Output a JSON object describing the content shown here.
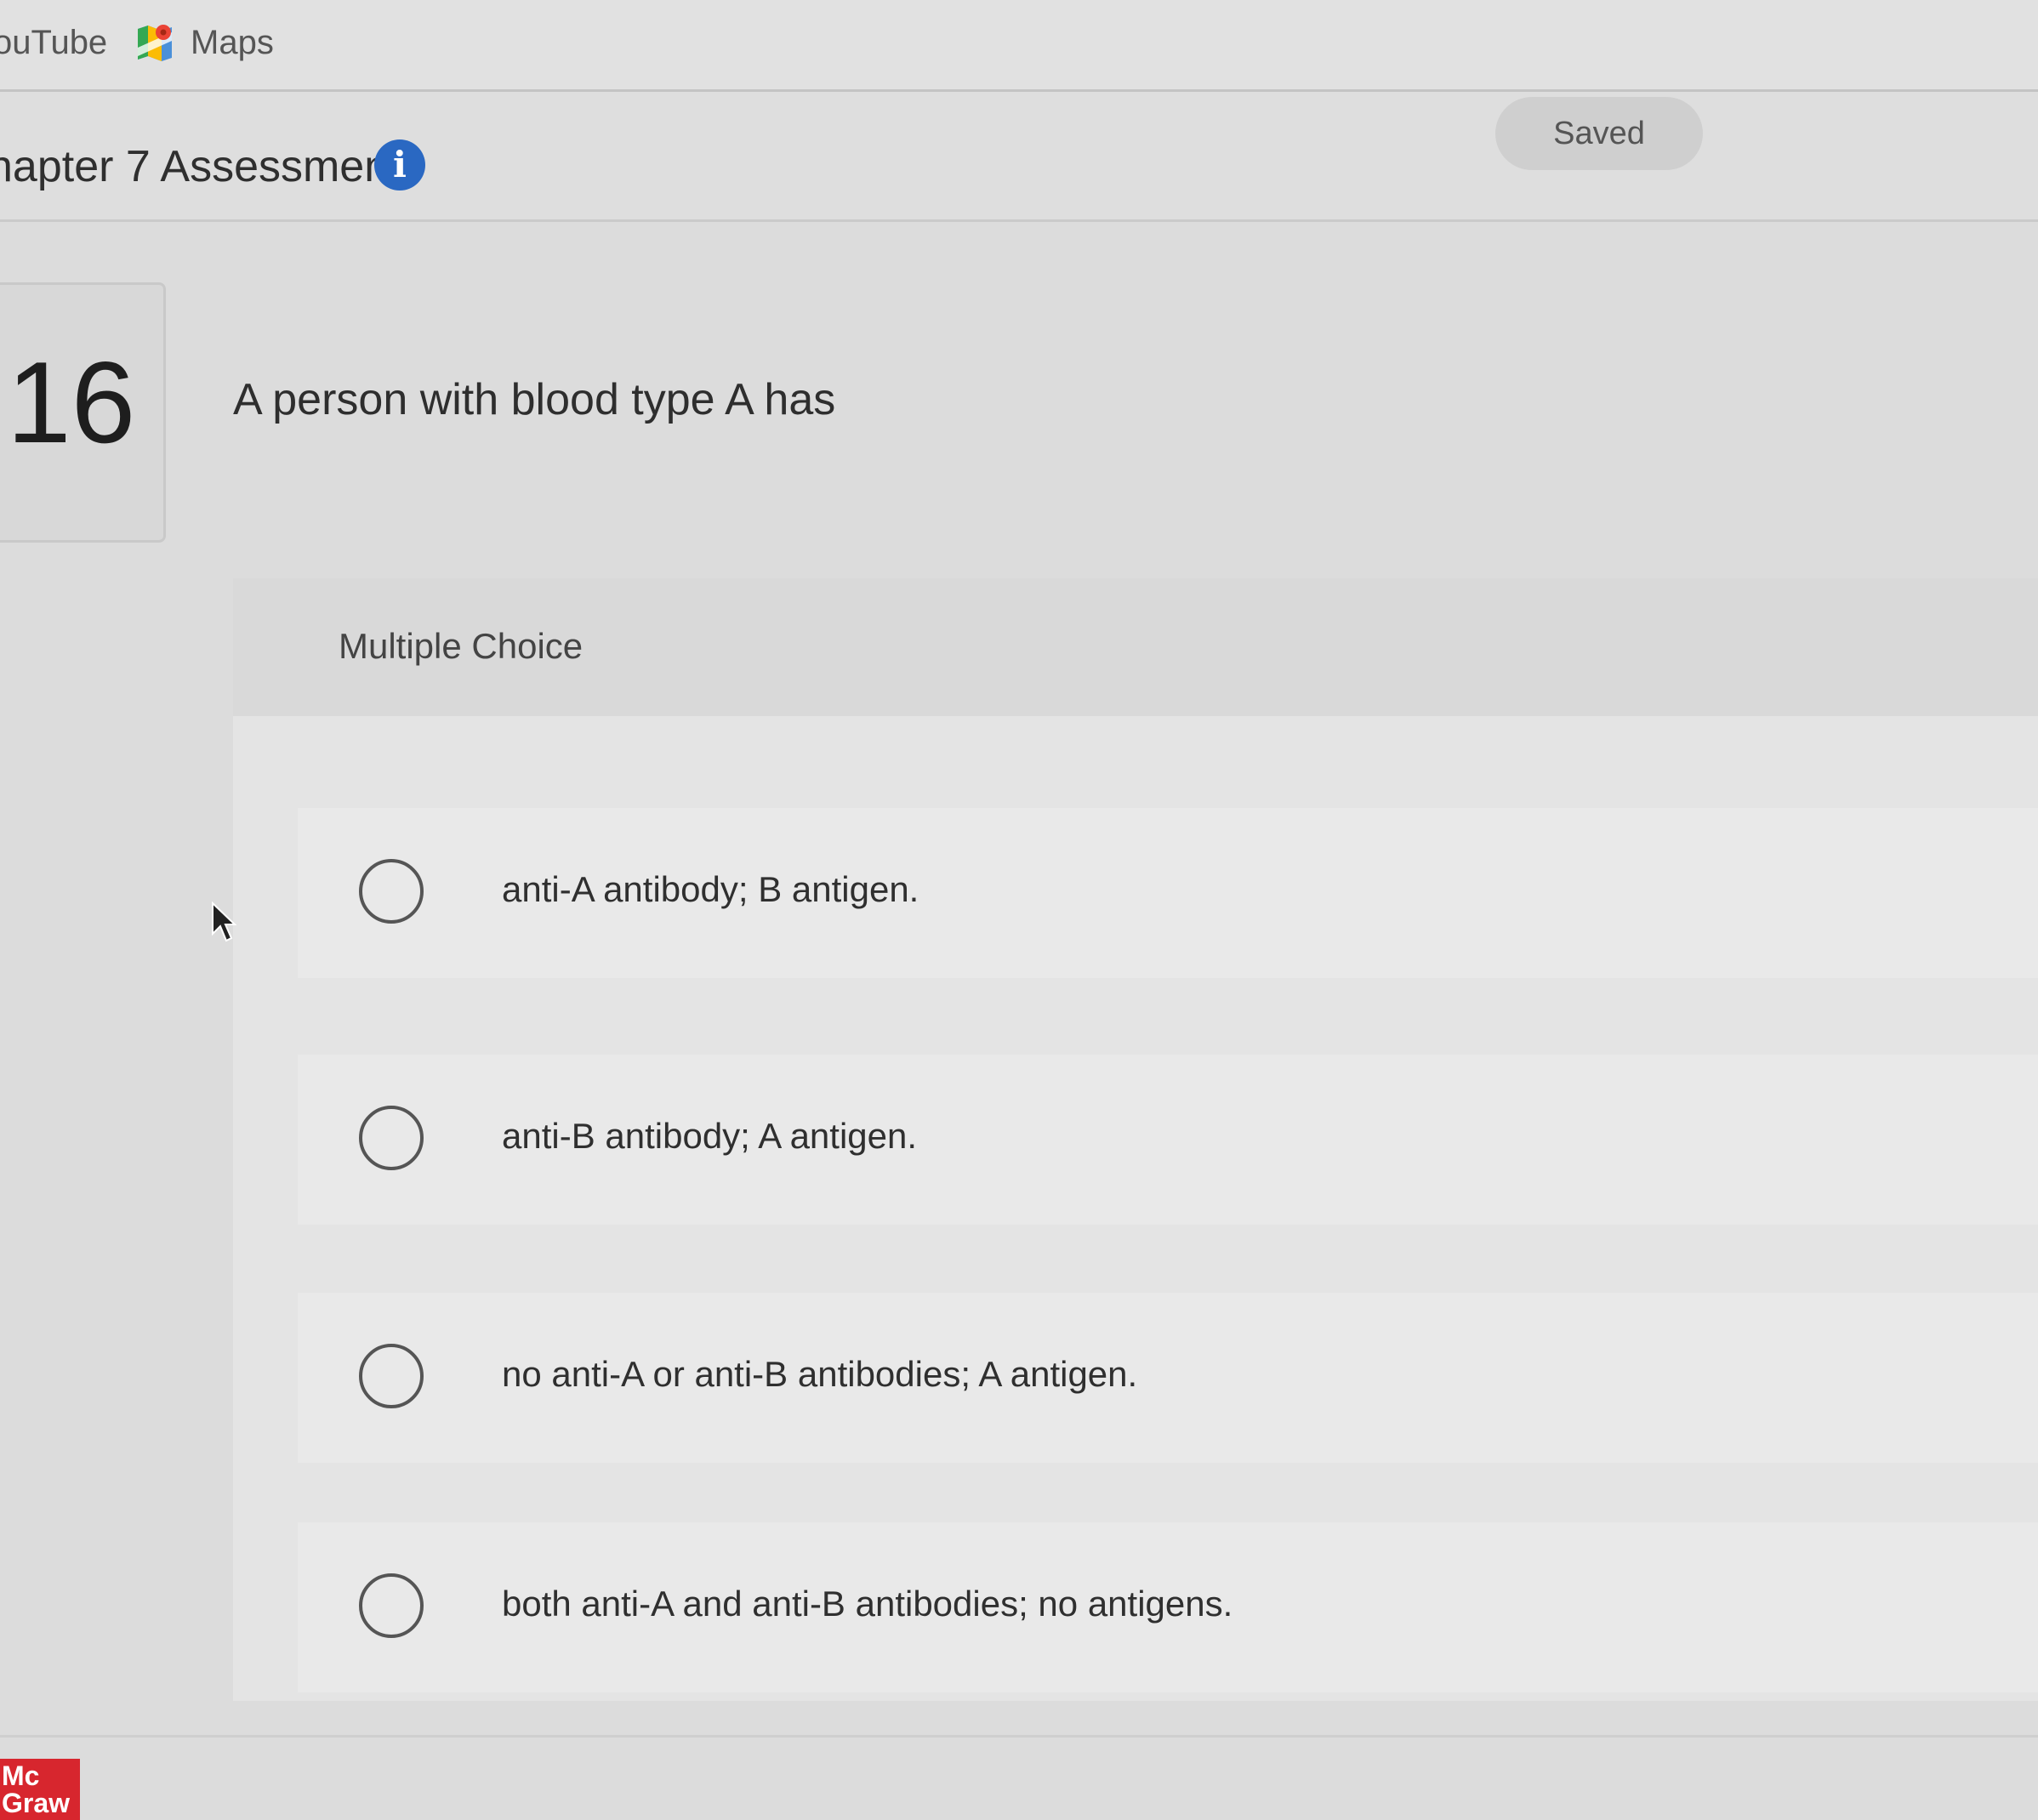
{
  "bookmarks": {
    "youtube_label": "ouTube",
    "maps_label": "Maps"
  },
  "header": {
    "title": "hapter 7 Assessment",
    "info_icon": "info-icon",
    "status_label": "Saved",
    "accent_color": "#2a68c2"
  },
  "question": {
    "number": "16",
    "text": "A person with blood type A has",
    "type_label": "Multiple Choice",
    "options": [
      {
        "label": "anti-A antibody; B antigen.",
        "selected": false
      },
      {
        "label": "anti-B antibody; A antigen.",
        "selected": false
      },
      {
        "label": "no anti-A or anti-B antibodies; A antigen.",
        "selected": false
      },
      {
        "label": "both anti-A and anti-B antibodies; no antigens.",
        "selected": false
      }
    ]
  },
  "footer": {
    "logo_line1": "Mc",
    "logo_line2": "Graw",
    "logo_color": "#d7262e"
  }
}
